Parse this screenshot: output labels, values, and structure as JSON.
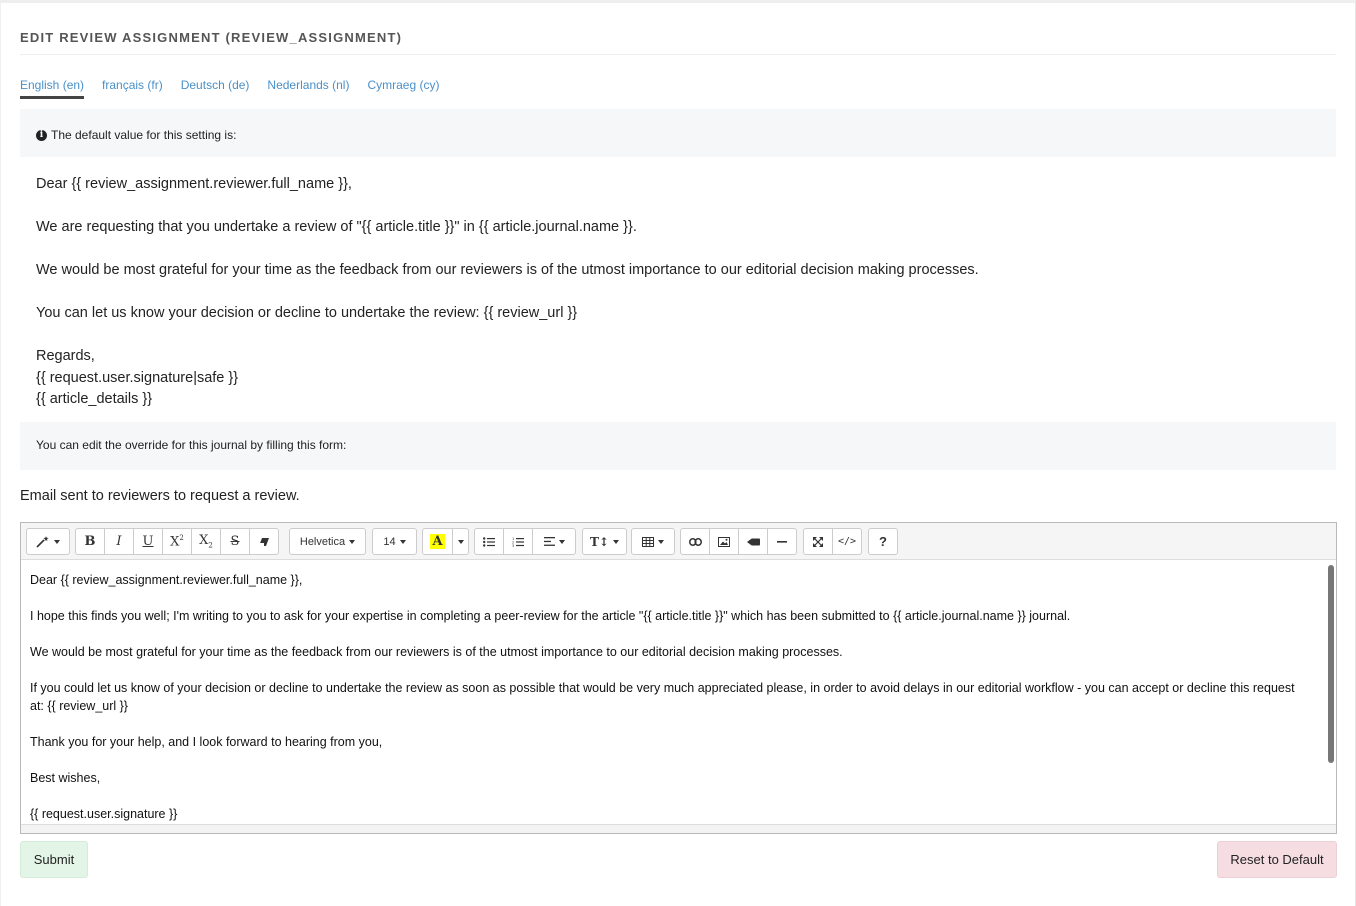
{
  "page": {
    "title": "EDIT REVIEW ASSIGNMENT (REVIEW_ASSIGNMENT)"
  },
  "tabs": [
    {
      "label": "English (en)",
      "active": true
    },
    {
      "label": "français (fr)",
      "active": false
    },
    {
      "label": "Deutsch (de)",
      "active": false
    },
    {
      "label": "Nederlands (nl)",
      "active": false
    },
    {
      "label": "Cymraeg (cy)",
      "active": false
    }
  ],
  "info": {
    "icon": "info-circle-icon",
    "default_label": "The default value for this setting is:",
    "default_lines": [
      "Dear {{ review_assignment.reviewer.full_name }},",
      "",
      "We are requesting that you undertake a review of \"{{ article.title }}\" in {{ article.journal.name }}.",
      "",
      "We would be most grateful for your time as the feedback from our reviewers is of the utmost importance to our editorial decision making processes.",
      "",
      "You can let us know your decision or decline to undertake the review: {{ review_url }}",
      "",
      "Regards,",
      "{{ request.user.signature|safe }}",
      "{{ article_details }}"
    ],
    "override_label": "You can edit the override for this journal by filling this form:"
  },
  "field": {
    "label": "Email sent to reviewers to request a review."
  },
  "toolbar": {
    "style_icon": "magic-wand-icon",
    "bold_icon": "bold-icon",
    "italic_icon": "italic-icon",
    "underline_icon": "underline-icon",
    "superscript_icon": "superscript-icon",
    "subscript_icon": "subscript-icon",
    "strikethrough_icon": "strikethrough-icon",
    "clear_format_icon": "eraser-icon",
    "font_name": "Helvetica",
    "font_size": "14",
    "color_icon": "text-color-icon",
    "ul_icon": "unordered-list-icon",
    "ol_icon": "ordered-list-icon",
    "align_icon": "align-icon",
    "height_icon": "line-height-icon",
    "table_icon": "table-icon",
    "link_icon": "link-icon",
    "image_icon": "image-icon",
    "video_icon": "video-icon",
    "hr_icon": "horizontal-rule-icon",
    "fullscreen_icon": "fullscreen-icon",
    "code_icon": "code-view-icon",
    "help_label": "?",
    "highlight_color": "#ffff00"
  },
  "editor": {
    "lines": [
      "Dear {{ review_assignment.reviewer.full_name }},",
      "",
      "I hope this finds you well; I'm writing to you to ask for your expertise in completing a peer-review for the article \"{{ article.title }}\" which has been submitted to {{ article.journal.name }} journal.",
      "",
      "We would be most grateful for your time as the feedback from our reviewers is of the utmost importance to our editorial decision making processes.",
      "",
      "If you could let us know of your decision or decline to undertake the review as soon as possible that would be very much appreciated please, in order to avoid delays in our editorial workflow - you can accept or decline this request at: {{ review_url }}",
      "",
      "Thank you for your help, and I look forward to hearing from you,",
      "",
      "Best wishes,",
      "",
      "{{ request.user.signature }}"
    ]
  },
  "actions": {
    "submit_label": "Submit",
    "reset_label": "Reset to Default",
    "submit_color": "#e3f5e6",
    "reset_color": "#f5dde1"
  }
}
